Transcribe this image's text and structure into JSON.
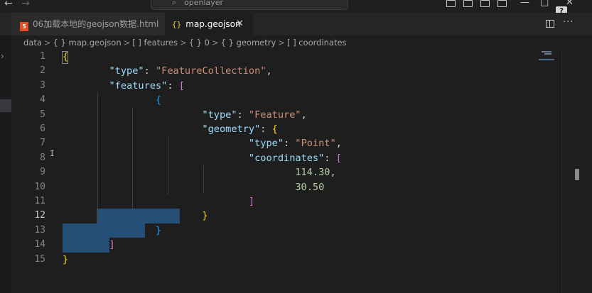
{
  "titlebar": {
    "search_placeholder": "openlayer",
    "back_icon": "arrow-left-icon",
    "forward_icon": "arrow-right-icon"
  },
  "help_badge": "?",
  "tabs": [
    {
      "label": "06加载本地的geojson数据.html",
      "icon": "html5-icon",
      "active": false
    },
    {
      "label": "map.geojson",
      "icon": "json-braces-icon",
      "active": true
    }
  ],
  "tab_icons": {
    "html": "5",
    "json": "{}"
  },
  "breadcrumb": {
    "items": [
      "data",
      "{ } map.geojson",
      "[ ] features",
      "{ } 0",
      "{ } geometry",
      "[ ] coordinates"
    ],
    "separator": ">"
  },
  "editor": {
    "active_line": 12,
    "line_numbers": [
      "1",
      "2",
      "3",
      "4",
      "5",
      "6",
      "7",
      "8",
      "9",
      "10",
      "11",
      "12",
      "13",
      "14",
      "15"
    ],
    "lines": [
      [
        {
          "t": "{",
          "c": "b1"
        }
      ],
      [
        {
          "t": "        ",
          "c": "punc"
        },
        {
          "t": "\"type\"",
          "c": "key"
        },
        {
          "t": ": ",
          "c": "punc"
        },
        {
          "t": "\"FeatureCollection\"",
          "c": "str"
        },
        {
          "t": ",",
          "c": "punc"
        }
      ],
      [
        {
          "t": "        ",
          "c": "punc"
        },
        {
          "t": "\"features\"",
          "c": "key"
        },
        {
          "t": ": ",
          "c": "punc"
        },
        {
          "t": "[",
          "c": "b2"
        }
      ],
      [
        {
          "t": "                ",
          "c": "punc"
        },
        {
          "t": "{",
          "c": "b3"
        }
      ],
      [
        {
          "t": "                        ",
          "c": "punc"
        },
        {
          "t": "\"type\"",
          "c": "key"
        },
        {
          "t": ": ",
          "c": "punc"
        },
        {
          "t": "\"Feature\"",
          "c": "str"
        },
        {
          "t": ",",
          "c": "punc"
        }
      ],
      [
        {
          "t": "                        ",
          "c": "punc"
        },
        {
          "t": "\"geometry\"",
          "c": "key"
        },
        {
          "t": ": ",
          "c": "punc"
        },
        {
          "t": "{",
          "c": "b1"
        }
      ],
      [
        {
          "t": "                                ",
          "c": "punc"
        },
        {
          "t": "\"type\"",
          "c": "key"
        },
        {
          "t": ": ",
          "c": "punc"
        },
        {
          "t": "\"Point\"",
          "c": "str"
        },
        {
          "t": ",",
          "c": "punc"
        }
      ],
      [
        {
          "t": "                                ",
          "c": "punc"
        },
        {
          "t": "\"coordinates\"",
          "c": "key"
        },
        {
          "t": ": ",
          "c": "punc"
        },
        {
          "t": "[",
          "c": "b2"
        }
      ],
      [
        {
          "t": "                                        ",
          "c": "punc"
        },
        {
          "t": "114.30",
          "c": "num"
        },
        {
          "t": ",",
          "c": "punc"
        }
      ],
      [
        {
          "t": "                                        ",
          "c": "punc"
        },
        {
          "t": "30.50",
          "c": "num"
        }
      ],
      [
        {
          "t": "                                ",
          "c": "punc"
        },
        {
          "t": "]",
          "c": "b2"
        }
      ],
      [
        {
          "t": "                        ",
          "c": "punc"
        },
        {
          "t": "}",
          "c": "b1"
        }
      ],
      [
        {
          "t": "                ",
          "c": "punc"
        },
        {
          "t": "}",
          "c": "b3"
        }
      ],
      [
        {
          "t": "        ",
          "c": "punc"
        },
        {
          "t": "]",
          "c": "b2"
        }
      ],
      [
        {
          "t": "}",
          "c": "b1"
        }
      ]
    ]
  },
  "colors": {
    "background": "#1e1e1e",
    "selection": "#264f78",
    "key": "#9cdcfe",
    "string": "#ce9178",
    "number": "#b5cea8",
    "bracket_gold": "#ffd700",
    "bracket_purple": "#da70d6",
    "bracket_blue": "#179fff"
  }
}
